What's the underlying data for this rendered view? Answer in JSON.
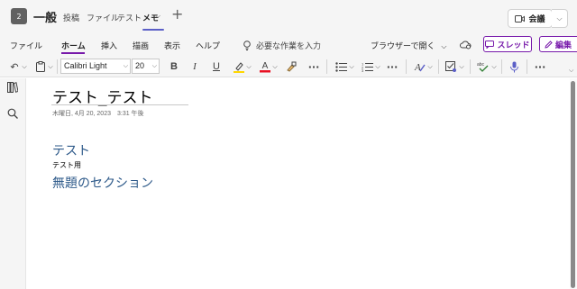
{
  "header": {
    "team_avatar": "2",
    "channel": "一般",
    "tabs": [
      {
        "label": "投稿"
      },
      {
        "label": "ファイル"
      },
      {
        "label": "テスト"
      },
      {
        "label": "メモ"
      }
    ],
    "meeting_label": "会議"
  },
  "ribbon": {
    "tabs": [
      {
        "label": "ファイル"
      },
      {
        "label": "ホーム"
      },
      {
        "label": "挿入"
      },
      {
        "label": "描画"
      },
      {
        "label": "表示"
      },
      {
        "label": "ヘルプ"
      }
    ],
    "tell_me": "必要な作業を入力",
    "open_in_browser": "ブラウザーで開く",
    "share_label": "スレッド",
    "edit_label": "編集"
  },
  "toolbar": {
    "font": "Calibri Light",
    "size": "20"
  },
  "page": {
    "title": "テスト_テスト",
    "date": "木曜日, 4月 20, 2023　3:31 午後",
    "heading1": "テスト",
    "body": "テスト用",
    "heading2": "無題のセクション"
  },
  "colors": {
    "accent": "#5b5fc7",
    "onenote": "#7719aa",
    "heading": "#2e5a8a",
    "font_color": "#e81123",
    "highlight": "#ffd700"
  }
}
